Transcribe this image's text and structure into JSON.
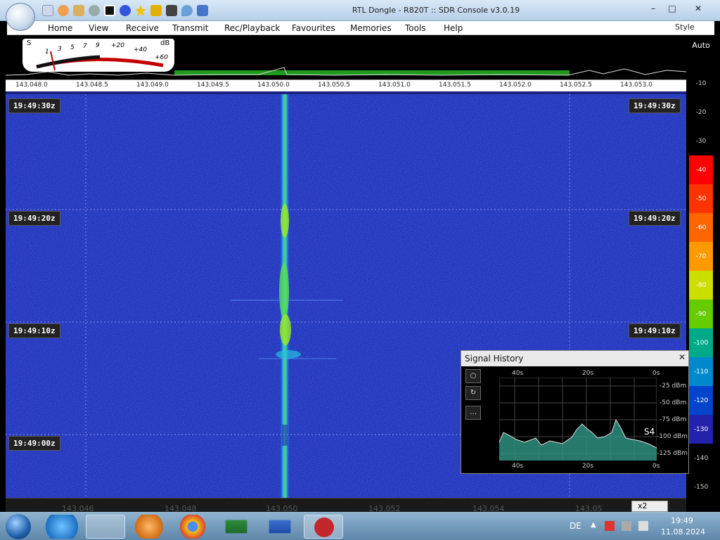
{
  "window": {
    "title": "RTL Dongle - R820T :: SDR Console v3.0.19"
  },
  "menu": {
    "items": [
      "Home",
      "View",
      "Receive",
      "Transmit",
      "Rec/Playback",
      "Favourites",
      "Memories",
      "Tools",
      "Help"
    ],
    "style_label": "Style"
  },
  "meter": {
    "s_label": "S",
    "db_label": "dB",
    "scale_labels": [
      "1",
      "3",
      "5",
      "7",
      "9",
      "+20",
      "+40",
      "+60"
    ]
  },
  "spectrum": {
    "freq_labels": [
      "143.048.0",
      "143.048.5",
      "143.049.0",
      "143.049.5",
      "143.050.0",
      "143.050.5",
      "143.051.0",
      "143.051.5",
      "143.052.0",
      "143.052.5",
      "143.053.0"
    ]
  },
  "waterfall": {
    "time_labels": [
      "19:49:30z",
      "19:49:20z",
      "19:49:10z",
      "19:49:00z"
    ]
  },
  "db_scale": {
    "auto_label": "Auto",
    "ticks": [
      "-10",
      "-20",
      "-30",
      "-40",
      "-50",
      "-60",
      "-70",
      "-80",
      "-90",
      "-100",
      "-110",
      "-120",
      "-130",
      "-140",
      "-150"
    ],
    "tick_colors": [
      "#ff0000",
      "#ff3300",
      "#ff6600",
      "#ff9900",
      "#ccdd00",
      "#66cc00",
      "#00aa88",
      "#0088cc",
      "#0044cc",
      "#2222aa"
    ]
  },
  "bottom": {
    "freq_labels": [
      "143.046",
      "143.048",
      "143.050",
      "143.052",
      "143.054",
      "143.05"
    ],
    "zoom_label": "x2"
  },
  "signal_history": {
    "title": "Signal History",
    "time_top": [
      "40s",
      "20s",
      "0s"
    ],
    "time_bottom": [
      "40s",
      "20s",
      "0s"
    ],
    "db_labels": [
      "-25 dBm",
      "-50 dBm",
      "-75 dBm",
      "-100 dBm",
      "-125 dBm"
    ],
    "s_reading": "S4"
  },
  "taskbar": {
    "lang": "DE",
    "time": "19:49",
    "date": "11.08.2024"
  }
}
